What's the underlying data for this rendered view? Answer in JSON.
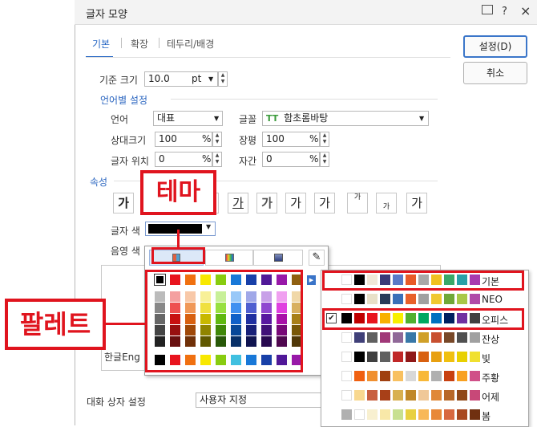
{
  "window": {
    "title": "글자 모양",
    "close_icon": "×",
    "help_icon": "?",
    "pin_icon": "▭"
  },
  "tabs": [
    {
      "label": "기본",
      "active": true
    },
    {
      "label": "확장"
    },
    {
      "label": "테두리/배경"
    }
  ],
  "buttons": {
    "ok": "설정(D)",
    "cancel": "취소"
  },
  "base_size": {
    "label": "기준 크기",
    "value": "10.0",
    "unit": "pt"
  },
  "language_section": {
    "title": "언어별 설정",
    "language_label": "언어",
    "language_value": "대표",
    "font_label": "글꼴",
    "font_value": "함초롬바탕",
    "font_icon": "TT",
    "rel_size_label": "상대크기",
    "rel_size_value": "100",
    "rel_size_unit": "%",
    "width_label": "장평",
    "width_value": "100",
    "width_unit": "%",
    "position_label": "글자 위치",
    "position_value": "0",
    "position_unit": "%",
    "spacing_label": "자간",
    "spacing_value": "0",
    "spacing_unit": "%"
  },
  "attributes": {
    "title": "속성",
    "glyph": "가",
    "text_color_label": "글자 색",
    "text_color_value": "#000000",
    "shade_color_label": "음영 색"
  },
  "popup": {
    "tabs": [
      "theme-tab",
      "spectrum-tab",
      "custom-tab"
    ],
    "top_row": [
      "#000000",
      "#e8141e",
      "#f07010",
      "#f8e800",
      "#88cc10",
      "#1878d8",
      "#1840a8",
      "#501898",
      "#9818a8",
      "#906010"
    ],
    "shade_columns": [
      [
        "#bbbbbb",
        "#888888",
        "#666666",
        "#444444",
        "#222222"
      ],
      [
        "#f4a0a0",
        "#ee5050",
        "#c81010",
        "#981010",
        "#681010"
      ],
      [
        "#f8c8a8",
        "#f09858",
        "#d86010",
        "#a04808",
        "#703008"
      ],
      [
        "#f8f098",
        "#f0e040",
        "#c8b800",
        "#908400",
        "#605800"
      ],
      [
        "#c8f098",
        "#98e040",
        "#60b810",
        "#408808",
        "#285808"
      ],
      [
        "#98c8f8",
        "#4090f0",
        "#1060c8",
        "#084898",
        "#083068"
      ],
      [
        "#a0a8e8",
        "#5060d0",
        "#2030a0",
        "#182078",
        "#101450"
      ],
      [
        "#c8a0e8",
        "#9048d0",
        "#5818a0",
        "#401078",
        "#280850"
      ],
      [
        "#f0a0f0",
        "#e040e0",
        "#a810a8",
        "#780878",
        "#500850"
      ],
      [
        "#f0d8a8",
        "#d8b060",
        "#a88018",
        "#785808",
        "#503808"
      ]
    ],
    "recent_row": [
      "#000000",
      "#e8141e",
      "#f07010",
      "#f8e800",
      "#88cc10",
      "#40c0e0",
      "#1878d8",
      "#1840a8",
      "#501898",
      "#9818a8"
    ],
    "sample_text": "한글Eng"
  },
  "palettes": [
    {
      "name": "기본",
      "selected": false,
      "colors": [
        "#ffffff",
        "#000000",
        "#f0e8d8",
        "#3a3a78",
        "#5a7ac8",
        "#e85a28",
        "#a8a8a8",
        "#f0c020",
        "#3aa868",
        "#28a0a8",
        "#a83ab0"
      ]
    },
    {
      "name": "NEO",
      "selected": false,
      "colors": [
        "#ffffff",
        "#000000",
        "#e8e0c8",
        "#283a58",
        "#3a70b8",
        "#e8602a",
        "#a0a0a0",
        "#f0c830",
        "#70a838",
        "#a8c848",
        "#b04aa8"
      ]
    },
    {
      "name": "오피스",
      "selected": true,
      "colors": [
        "#000000",
        "#c00000",
        "#e8141e",
        "#f8b000",
        "#f8f000",
        "#50b030",
        "#00a860",
        "#0070c0",
        "#002060",
        "#7030a0",
        "#404040"
      ]
    },
    {
      "name": "잔상",
      "selected": false,
      "colors": [
        "#ffffff",
        "#404078",
        "#606060",
        "#a03878",
        "#906898",
        "#3878a8",
        "#d0a028",
        "#c85030",
        "#784828",
        "#505050",
        "#a0a0a0"
      ]
    },
    {
      "name": "빛",
      "selected": false,
      "colors": [
        "#ffffff",
        "#000000",
        "#404040",
        "#606060",
        "#c02828",
        "#901818",
        "#d86010",
        "#e8a010",
        "#f0c010",
        "#e8d000",
        "#f0e030"
      ]
    },
    {
      "name": "주황",
      "selected": false,
      "colors": [
        "#ffffff",
        "#f06010",
        "#f09030",
        "#a04010",
        "#f8c060",
        "#d8d8d8",
        "#f8b838",
        "#b0b0b0",
        "#c84010",
        "#f8a020",
        "#d05088"
      ]
    },
    {
      "name": "어제",
      "selected": false,
      "colors": [
        "#ffffff",
        "#f8d890",
        "#c86040",
        "#a84018",
        "#d8b050",
        "#c08828",
        "#f0c898",
        "#e08838",
        "#b86828",
        "#904818",
        "#c84878"
      ]
    },
    {
      "name": "봄",
      "selected": false,
      "colors": [
        "#b0b0b0",
        "#ffffff",
        "#f8f0d0",
        "#f8e8a8",
        "#c8e090",
        "#e8d040",
        "#f8b858",
        "#e88838",
        "#d86840",
        "#a84820",
        "#703010"
      ]
    }
  ],
  "callouts": {
    "theme": "테마",
    "palette": "팔레트"
  },
  "footer": {
    "label": "대화 상자 설정",
    "value": "사용자 지정"
  }
}
